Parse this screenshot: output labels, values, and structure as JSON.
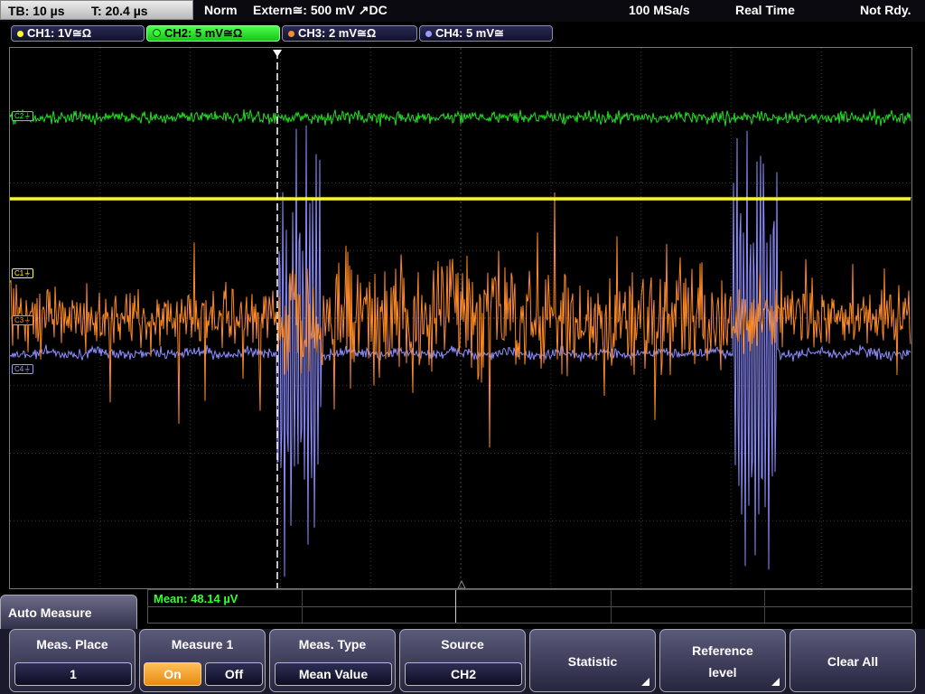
{
  "status_bar": {
    "timebase": "TB: 10 µs",
    "trigger_time": "T: 20.4 µs",
    "acq_mode": "Norm",
    "trigger_source": "Extern≅: 500 mV ↗DC",
    "sample_rate": "100 MSa/s",
    "acq_state": "Real Time",
    "ready_state": "Not Rdy."
  },
  "channels": [
    {
      "label": "CH1: 1V≅Ω",
      "color": "#ffff33",
      "active": false
    },
    {
      "label": "CH2: 5 mV≅Ω",
      "color": "#33ff33",
      "active": true
    },
    {
      "label": "CH3: 2 mV≅Ω",
      "color": "#ff8c2a",
      "active": false
    },
    {
      "label": "CH4: 5 mV≅",
      "color": "#9a9aff",
      "active": false
    }
  ],
  "trace_markers": {
    "c2": "C2⏚",
    "c1": "C1⏚",
    "c3": "C3⏚",
    "c4": "C4⏚"
  },
  "measurement": {
    "result": "Mean: 48.14 µV"
  },
  "menu": {
    "title": "Auto Measure",
    "meas_place": {
      "title": "Meas. Place",
      "value": "1"
    },
    "measure1": {
      "title": "Measure 1",
      "on": "On",
      "off": "Off",
      "selected": "On"
    },
    "meas_type": {
      "title": "Meas. Type",
      "value": "Mean Value"
    },
    "source": {
      "title": "Source",
      "value": "CH2"
    },
    "statistic": {
      "title": "Statistic"
    },
    "reference": {
      "line1": "Reference",
      "line2": "level"
    },
    "clear_all": {
      "title": "Clear All"
    }
  },
  "colors": {
    "ch1": "#ffff33",
    "ch2": "#22dd22",
    "ch3": "#ff8a25",
    "ch4": "#8c8cff",
    "grid": "#3a3a3a"
  }
}
